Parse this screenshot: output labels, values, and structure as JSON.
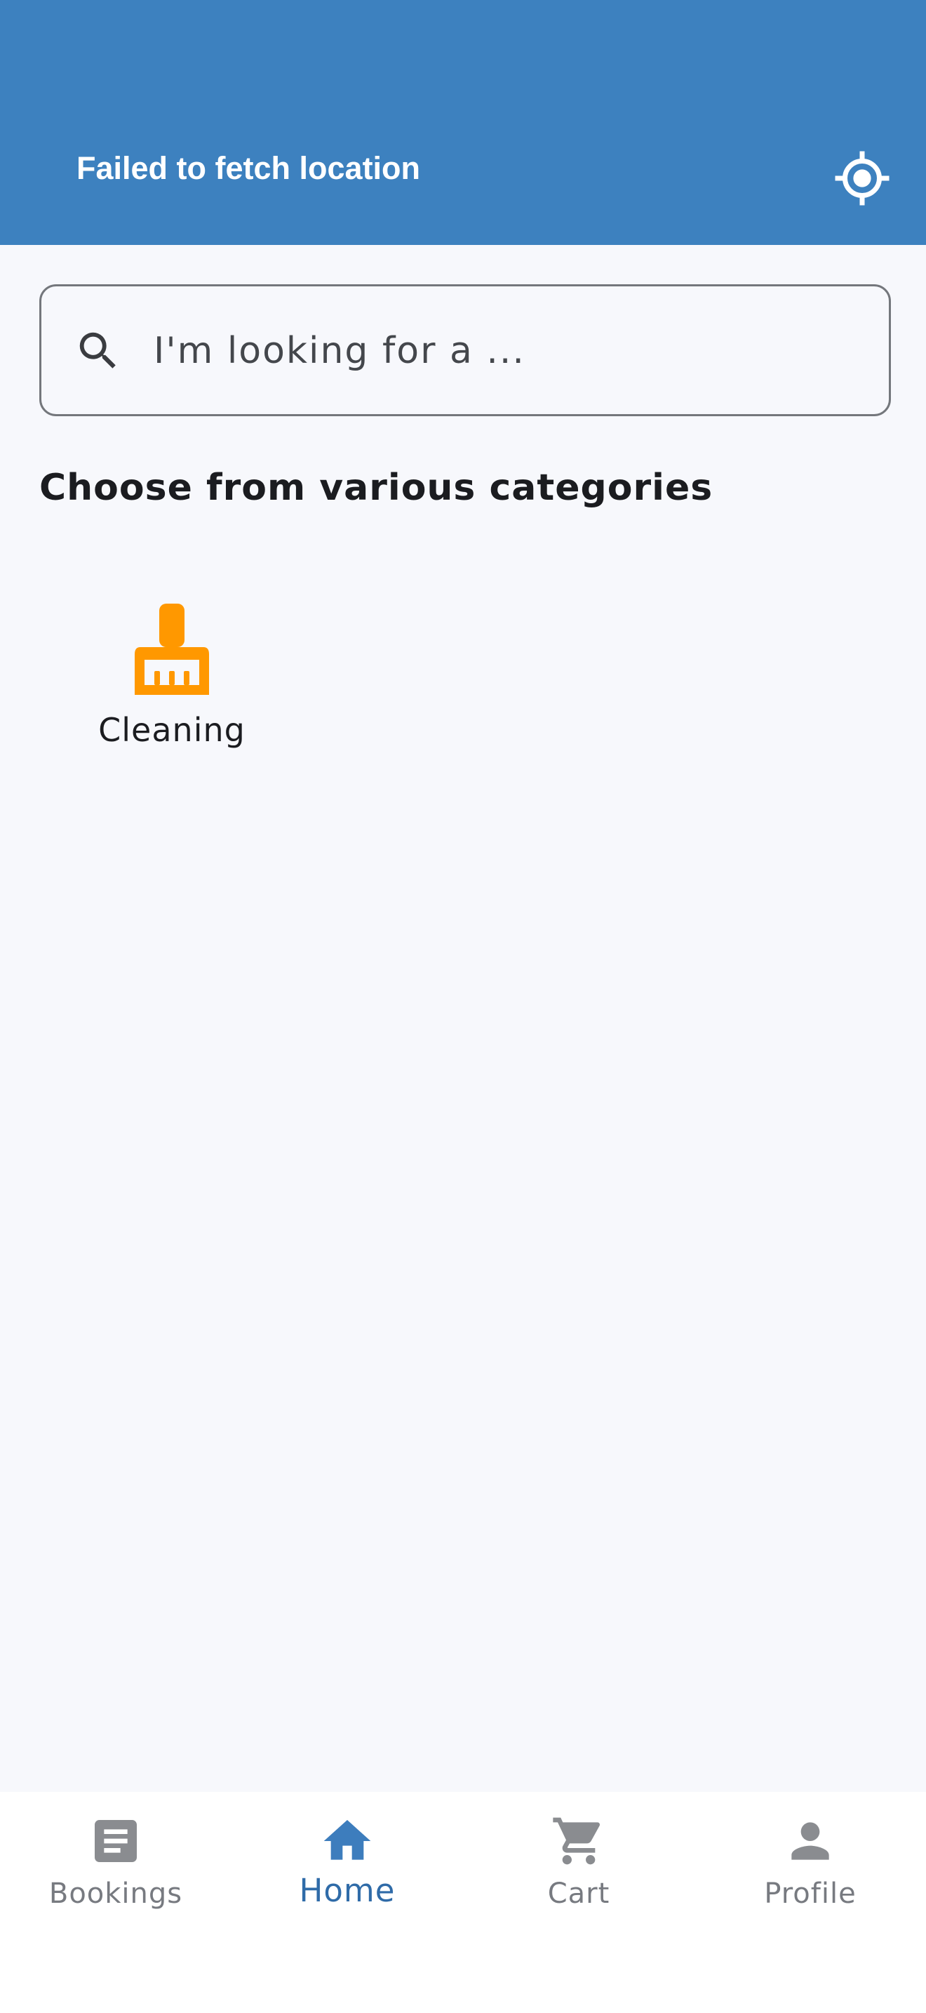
{
  "header": {
    "location_text": "Failed to fetch location",
    "locate_icon": "my-location-icon",
    "background_color": "#3d81bf"
  },
  "search": {
    "placeholder": "I'm looking for a ...",
    "value": "",
    "icon": "search-icon"
  },
  "categories_section": {
    "title": "Choose from various categories",
    "items": [
      {
        "label": "Cleaning",
        "icon": "cleaning-brush-icon",
        "color": "#ff9800"
      }
    ]
  },
  "bottom_nav": {
    "active_color": "#2f6ba8",
    "inactive_color": "#777a80",
    "items": [
      {
        "label": "Bookings",
        "icon": "article-icon",
        "active": false
      },
      {
        "label": "Home",
        "icon": "home-icon",
        "active": true
      },
      {
        "label": "Cart",
        "icon": "cart-icon",
        "active": false
      },
      {
        "label": "Profile",
        "icon": "person-icon",
        "active": false
      }
    ]
  }
}
